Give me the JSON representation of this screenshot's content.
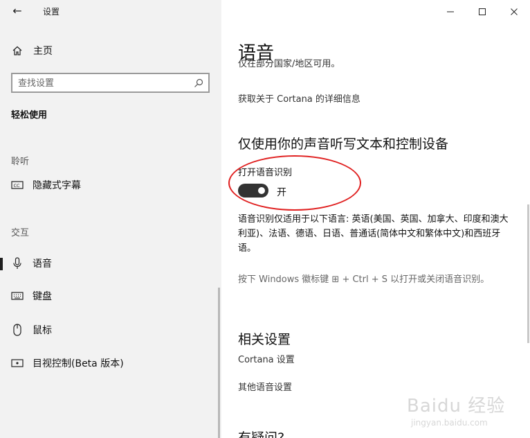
{
  "window": {
    "title": "设置",
    "controls": [
      "minimize-icon",
      "maximize-icon",
      "close-icon"
    ]
  },
  "nav": {
    "home_label": "主页",
    "search_placeholder": "查找设置",
    "section_title": "轻松使用",
    "groups": [
      {
        "label": "聆听",
        "items": [
          {
            "label": "隐藏式字幕",
            "icon": "closed-captions-icon"
          }
        ]
      },
      {
        "label": "交互",
        "items": [
          {
            "label": "语音",
            "icon": "microphone-icon",
            "active": true
          },
          {
            "label": "键盘",
            "icon": "keyboard-icon"
          },
          {
            "label": "鼠标",
            "icon": "mouse-icon"
          },
          {
            "label": "目视控制(Beta 版本)",
            "icon": "eye-control-icon"
          }
        ]
      }
    ]
  },
  "content": {
    "page_title": "语音",
    "cut_text": "仅在部分国家/地区可用。",
    "cortana_link": "获取关于 Cortana 的详细信息",
    "dictation_heading": "仅使用你的声音听写文本和控制设备",
    "toggle_label": "打开语音识别",
    "toggle_state": "开",
    "toggle_on": true,
    "languages_text": "语音识别仅适用于以下语言: 英语(美国、英国、加拿大、印度和澳大利亚)、法语、德语、日语、普通话(简体中文和繁体中文)和西班牙语。",
    "shortcut_text": "按下 Windows 徽标键 ⊞ + Ctrl + S 以打开或关闭语音识别。",
    "related_heading": "相关设置",
    "related_links": [
      "Cortana 设置",
      "其他语音设置"
    ],
    "question_heading": "有疑问?"
  },
  "watermark": {
    "logo": "Baidu 经验",
    "sub": "jingyan.baidu.com"
  },
  "colors": {
    "nav_bg": "#f2f2f2",
    "toggle_on": "#333333",
    "annotation": "#e02020"
  }
}
